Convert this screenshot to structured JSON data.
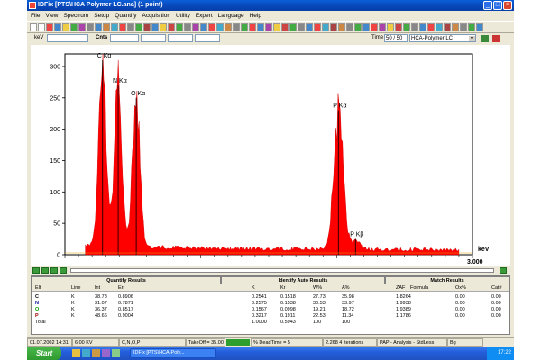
{
  "window": {
    "title": "IDFix [PTS\\HCA Polymer LC.ana] (1 point)"
  },
  "menu": [
    "File",
    "View",
    "Spectrum",
    "Setup",
    "Quantify",
    "Acquisition",
    "Utility",
    "Expert",
    "Language",
    "Help"
  ],
  "row2": {
    "kev_label": "keV",
    "cnts_label": "Cnts",
    "time_label": "Time",
    "time_value": "50 / 50",
    "preset": "HCA-Polymer LC"
  },
  "chart_data": {
    "type": "area",
    "color": "#ff0000",
    "xlabel": "keV",
    "x_max_label": "3.000",
    "ylim": [
      0,
      320
    ],
    "xlim": [
      0,
      3.0
    ],
    "y_ticks": [
      0,
      50,
      100,
      150,
      200,
      250,
      300
    ],
    "peaks": [
      {
        "label": "C Kα",
        "x": 0.277,
        "y": 310
      },
      {
        "label": "N Kα",
        "x": 0.392,
        "y": 270
      },
      {
        "label": "O Kα",
        "x": 0.525,
        "y": 250
      },
      {
        "label": "P Kα",
        "x": 2.013,
        "y": 230
      },
      {
        "label": "P Kβ",
        "x": 2.139,
        "y": 25
      }
    ]
  },
  "results": {
    "section_titles": [
      "Quantify Results",
      "Identify Auto Results",
      "Match Results"
    ],
    "columns": [
      "Elt",
      "Line",
      "Int",
      "Err",
      "K",
      "Kr",
      "W%",
      "A%",
      "ZAF",
      "Formula",
      "Ox%",
      "Cat#"
    ],
    "rows": [
      [
        "C",
        "K",
        "38.78",
        "0.8906",
        "0.2541",
        "0.1518",
        "27.73",
        "35.98",
        "1.8264",
        "",
        "0.00",
        "0.00"
      ],
      [
        "N",
        "K",
        "31.07",
        "0.7871",
        "0.2575",
        "0.1538",
        "30.53",
        "33.97",
        "1.9938",
        "",
        "0.00",
        "0.00"
      ],
      [
        "O",
        "K",
        "36.37",
        "0.8517",
        "0.1567",
        "0.0998",
        "19.21",
        "18.72",
        "1.9389",
        "",
        "0.00",
        "0.00"
      ],
      [
        "P",
        "K",
        "48.66",
        "0.9004",
        "0.3217",
        "0.1911",
        "22.53",
        "11.34",
        "1.1786",
        "",
        "0.00",
        "0.00"
      ]
    ],
    "total": {
      "label": "Total",
      "k": "1.0000",
      "kr": "0.5943",
      "w": "100",
      "a": "100"
    }
  },
  "status": {
    "datetime": "01.07.2002 14:31",
    "kv": "6.00 KV",
    "elements": "C,N,O,P",
    "takeoff": "TakeOff = 35.00",
    "deadtime": "% DeadTime = 5",
    "iterations": "2.268  4 iterations",
    "method": "PAP - Analysis - StdLess",
    "bg": "Bg"
  },
  "taskbar": {
    "start": "Start",
    "task1": "IDFix [PTS\\HCA-Poly...",
    "clock": "17:22"
  }
}
